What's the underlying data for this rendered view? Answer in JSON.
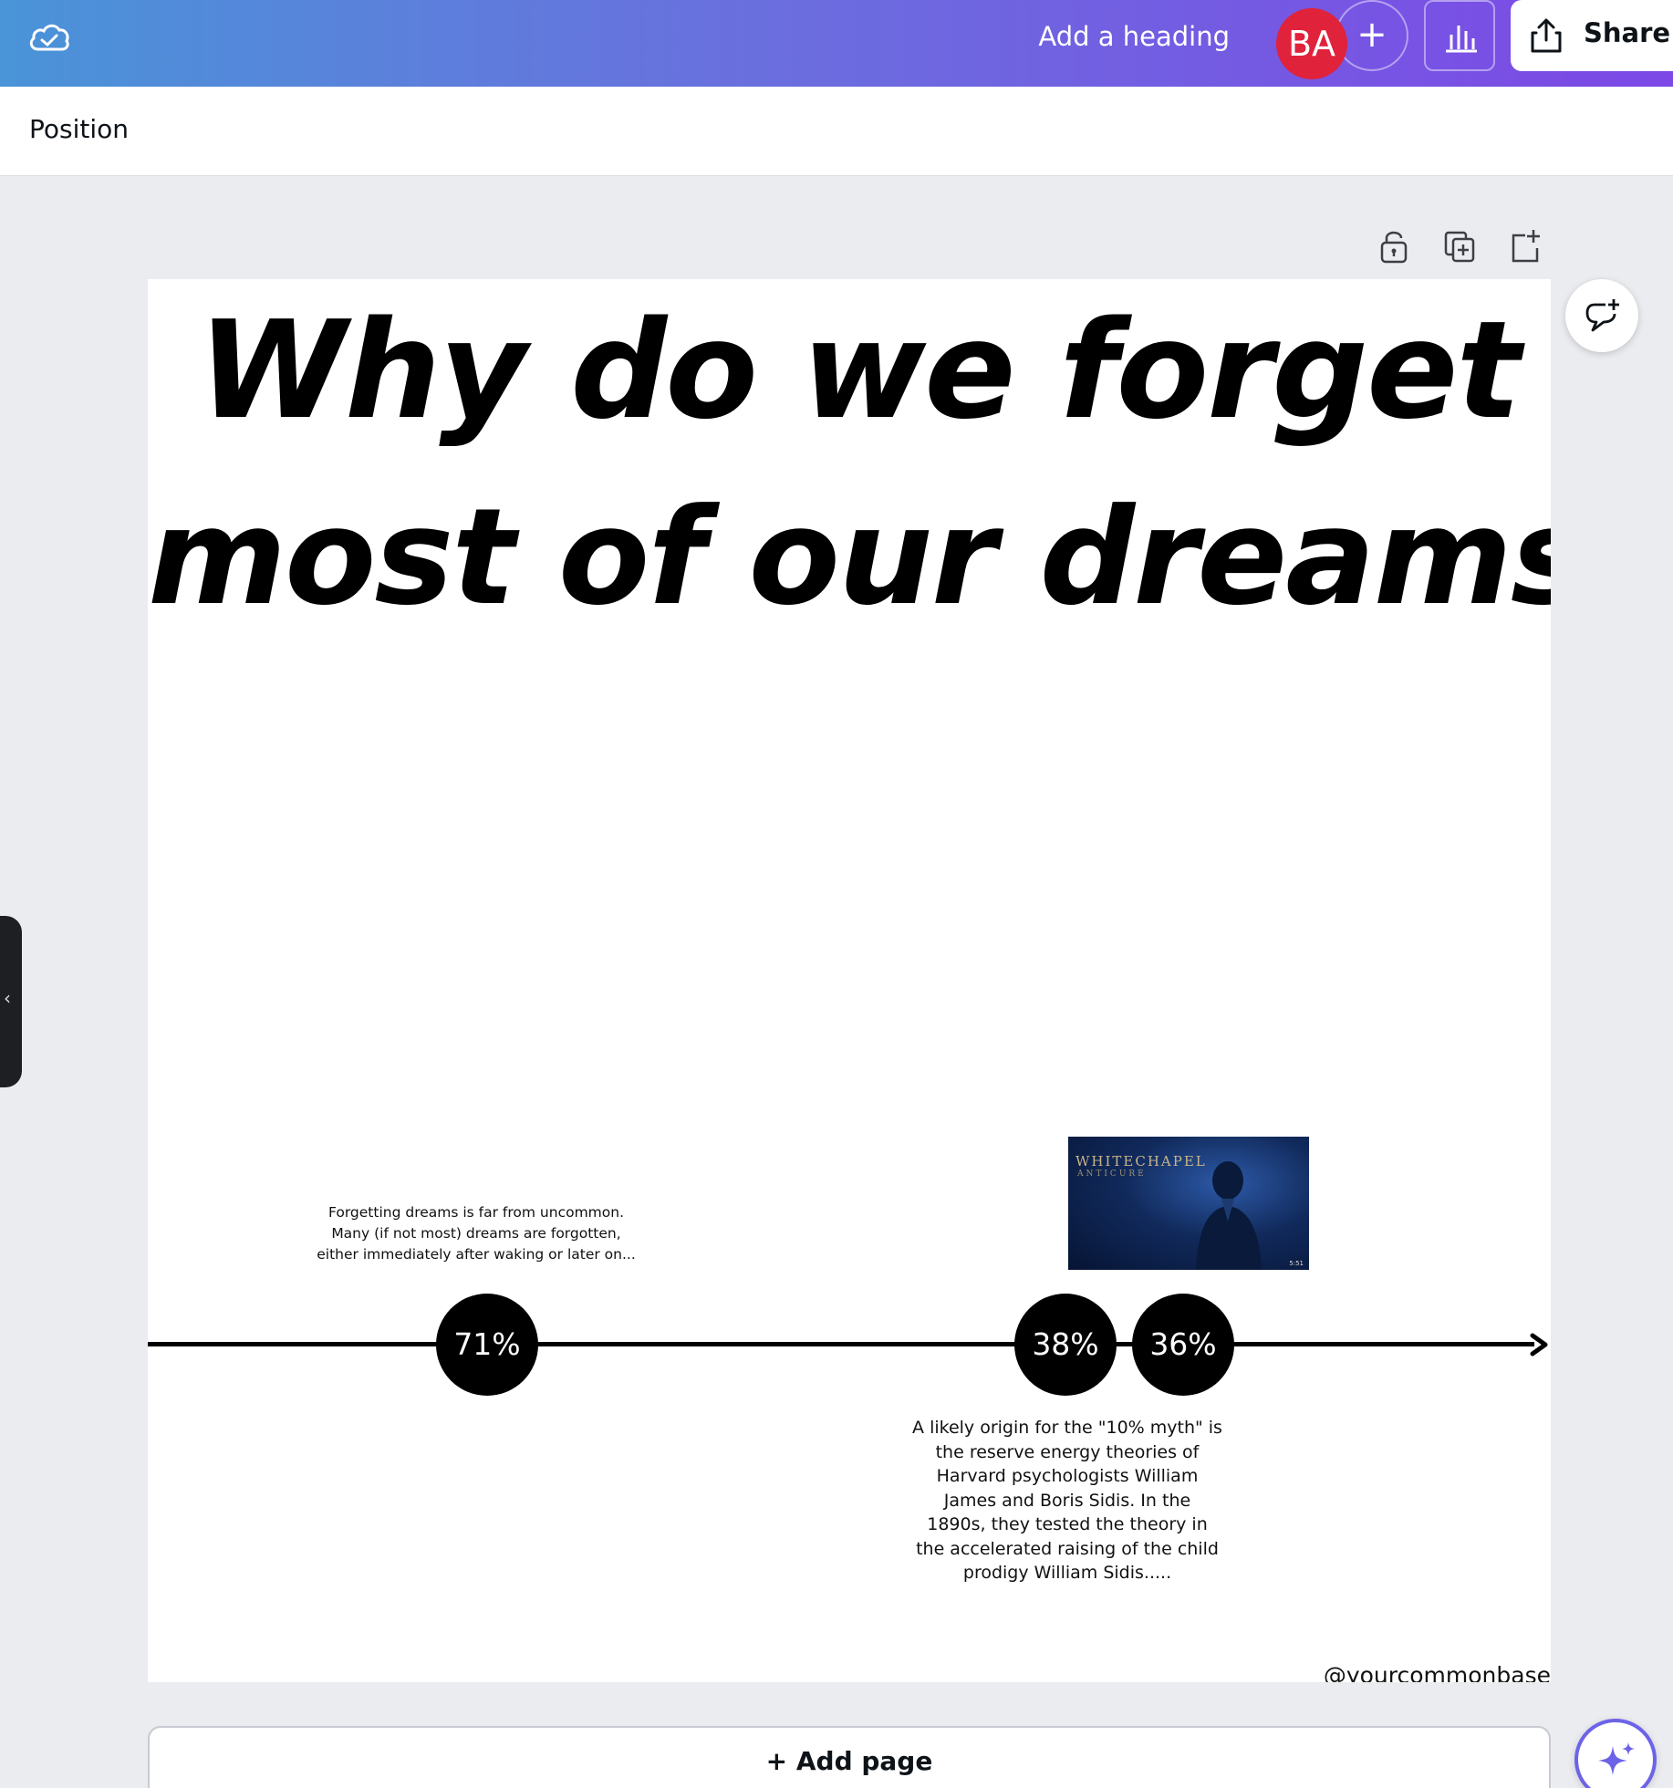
{
  "topbar": {
    "heading_label": "Add a heading",
    "avatar_initials": "BA",
    "add_collaborator_symbol": "+",
    "share_label": "Share",
    "icons": [
      "cloud-check-icon",
      "bar-chart-icon",
      "share-upload-icon"
    ]
  },
  "subbar": {
    "position_label": "Position"
  },
  "page_tools": {
    "icons": [
      "unlock-icon",
      "duplicate-page-icon",
      "add-page-icon"
    ]
  },
  "canvas": {
    "title_line1": "Why do we forget",
    "title_line2": "most of our dreams?",
    "note1": "Forgetting dreams is far from uncommon. Many (if not most) dreams are forgotten, either immediately after waking or later on...",
    "bubbles": [
      "71%",
      "38%",
      "36%"
    ],
    "video": {
      "band": "WHITECHAPEL",
      "song": "ANTICURE",
      "duration": "5:51"
    },
    "note2": "A likely origin for the \"10% myth\" is the reserve energy theories of Harvard psychologists William James and Boris Sidis. In the 1890s, they tested the theory in the accelerated raising of the child prodigy William Sidis.....",
    "handle": "@yourcommonbase"
  },
  "add_page_label": "+ Add page",
  "colors": {
    "gradient_start": "#4a94d8",
    "gradient_end": "#7d48e6",
    "avatar": "#e0223a",
    "workspace": "#ebecf0",
    "magic_accent": "#6c63e8"
  }
}
